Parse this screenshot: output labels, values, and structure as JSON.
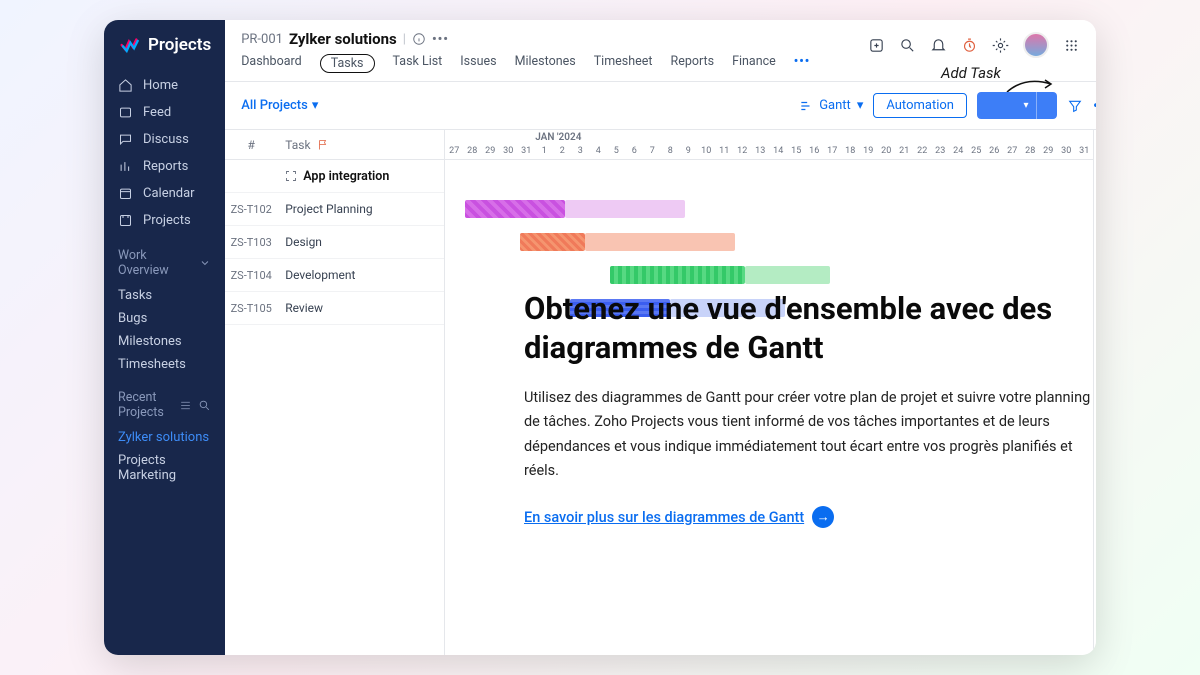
{
  "brand": "Projects",
  "sidebar": {
    "nav": [
      {
        "label": "Home"
      },
      {
        "label": "Feed"
      },
      {
        "label": "Discuss"
      },
      {
        "label": "Reports"
      },
      {
        "label": "Calendar"
      },
      {
        "label": "Projects"
      }
    ],
    "work_overview_header": "Work Overview",
    "work_items": [
      {
        "label": "Tasks"
      },
      {
        "label": "Bugs"
      },
      {
        "label": "Milestones"
      },
      {
        "label": "Timesheets"
      }
    ],
    "recent_header": "Recent Projects",
    "recent": [
      {
        "label": "Zylker solutions",
        "active": true
      },
      {
        "label": "Projects Marketing",
        "active": false
      }
    ]
  },
  "header": {
    "project_id": "PR-001",
    "project_name": "Zylker solutions",
    "tabs": [
      {
        "label": "Dashboard"
      },
      {
        "label": "Tasks",
        "active": true
      },
      {
        "label": "Task List"
      },
      {
        "label": "Issues"
      },
      {
        "label": "Milestones"
      },
      {
        "label": "Timesheet"
      },
      {
        "label": "Reports"
      },
      {
        "label": "Finance"
      }
    ]
  },
  "toolbar": {
    "all_projects": "All Projects",
    "gantt": "Gantt",
    "automation": "Automation",
    "annotation": "Add Task"
  },
  "gantt": {
    "month": "JAN '2024",
    "days": [
      "27",
      "28",
      "29",
      "30",
      "31",
      "1",
      "2",
      "3",
      "4",
      "5",
      "6",
      "7",
      "8",
      "9",
      "10",
      "11",
      "12",
      "13",
      "14",
      "15",
      "16",
      "17",
      "18",
      "19",
      "20",
      "21",
      "22",
      "23",
      "24",
      "25",
      "26",
      "27",
      "28",
      "29",
      "30",
      "31"
    ],
    "col_id": "#",
    "col_task": "Task",
    "group": "App integration",
    "rows": [
      {
        "id": "ZS-T102",
        "task": "Project Planning"
      },
      {
        "id": "ZS-T103",
        "task": "Design"
      },
      {
        "id": "ZS-T104",
        "task": "Development"
      },
      {
        "id": "ZS-T105",
        "task": "Review"
      }
    ]
  },
  "overlay": {
    "title": "Obtenez une vue d'ensemble avec des diagrammes de Gantt",
    "body": "Utilisez des diagrammes de Gantt pour créer votre plan de projet et suivre votre planning de tâches. Zoho Projects vous tient informé de vos tâches importantes et de leurs dépendances et vous indique immédiatement tout écart entre vos progrès planifiés et réels.",
    "link": "En savoir plus sur les diagrammes de Gantt"
  }
}
